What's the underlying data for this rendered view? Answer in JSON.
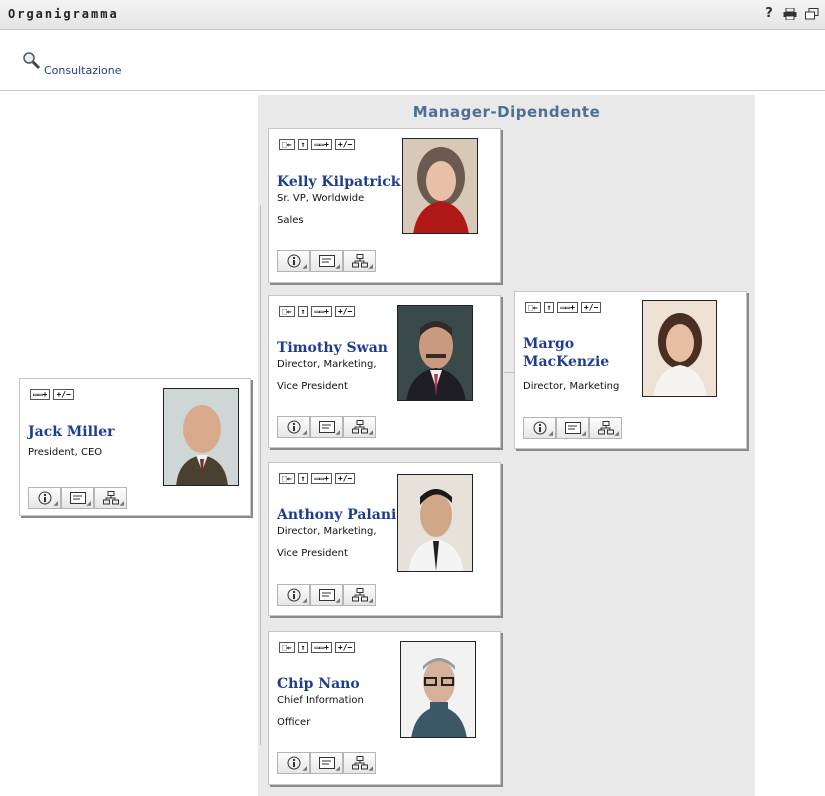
{
  "window": {
    "title": "Organigramma"
  },
  "toolbar": {
    "lookup_label": "Consultazione"
  },
  "chart": {
    "title": "Manager-Dipendente"
  },
  "card_controls": {
    "show_manager": "⬚←",
    "up": "↑",
    "show_reports": "▭▭+",
    "expand": "+/−"
  },
  "people": {
    "jack": {
      "name": "Jack Miller",
      "role": "President, CEO",
      "dept": ""
    },
    "kelly": {
      "name": "Kelly Kilpatrick",
      "role": "Sr. VP, Worldwide",
      "dept": "Sales"
    },
    "timothy": {
      "name": "Timothy Swan",
      "role": "Director, Marketing,",
      "dept": "Vice President"
    },
    "anthony": {
      "name": "Anthony Palani",
      "role": "Director, Marketing,",
      "dept": "Vice President"
    },
    "chip": {
      "name": "Chip Nano",
      "role": "Chief Information",
      "dept": "Officer"
    },
    "margo": {
      "name_line1": "Margo",
      "name_line2": "MacKenzie",
      "role": "Director, Marketing",
      "dept": ""
    }
  }
}
